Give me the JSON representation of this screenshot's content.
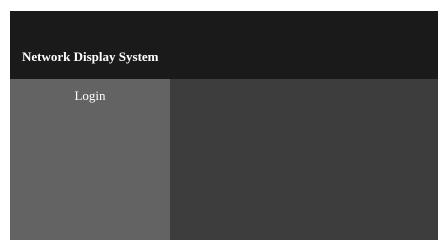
{
  "header": {
    "title": "Network Display System"
  },
  "sidebar": {
    "items": [
      {
        "label": "Login"
      }
    ]
  },
  "colors": {
    "header_bg": "#1a1a1a",
    "sidebar_bg": "#636363",
    "main_bg": "#3d3d3d",
    "text": "#ffffff"
  }
}
